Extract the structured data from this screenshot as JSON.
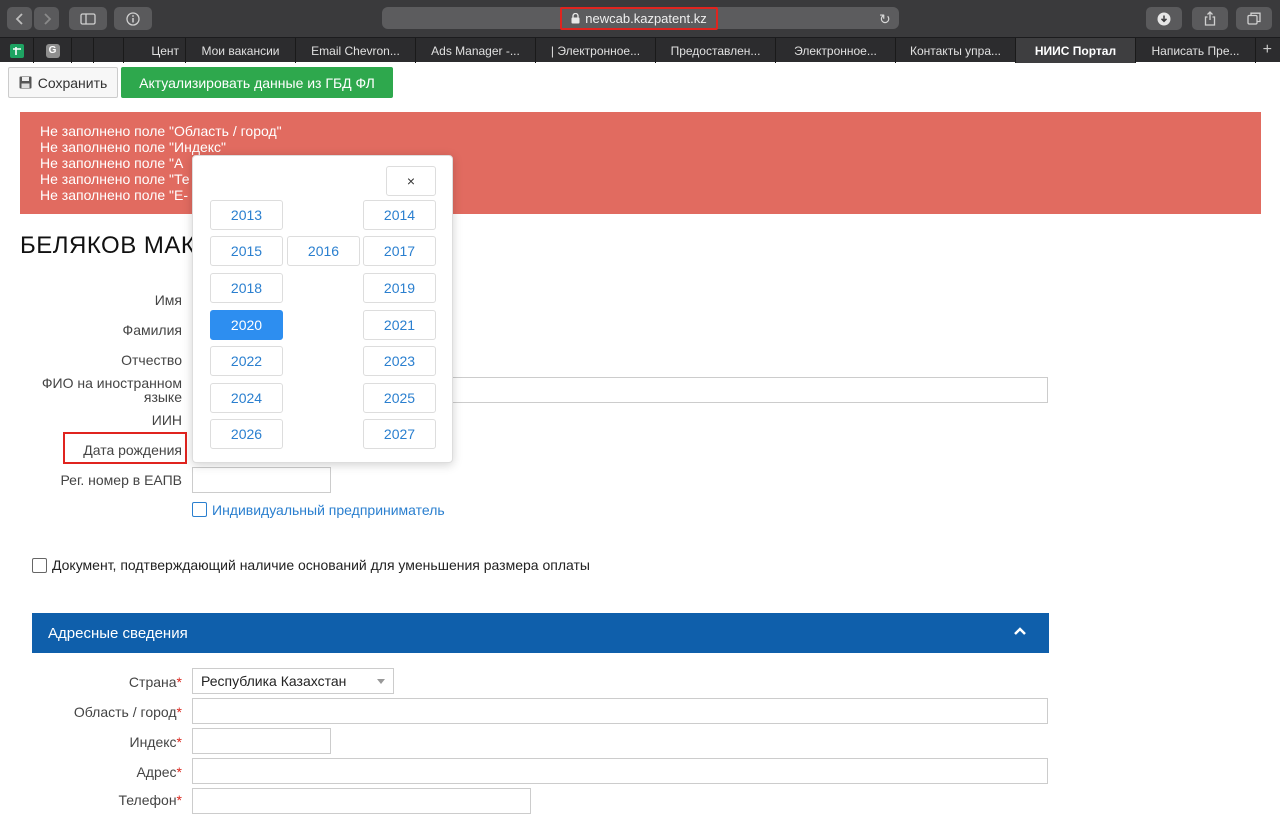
{
  "browser": {
    "url": "newcab.kazpatent.kz",
    "tabs": [
      "Цент",
      "Мои вакансии",
      "Email Chevron...",
      "Ads Manager -...",
      "| Электронное...",
      "Предоставлен...",
      "Электронное...",
      "Контакты упра...",
      "НИИС Портал",
      "Написать Пре..."
    ],
    "favicon_g": "G"
  },
  "toolbar": {
    "save_label": "Сохранить",
    "update_label": "Актуализировать данные из ГБД ФЛ"
  },
  "alert": {
    "lines": [
      "Не заполнено поле \"Область / город\"",
      "Не заполнено поле \"Индекс\"",
      "Не заполнено поле \"А",
      "Не заполнено поле \"Те",
      "Не заполнено поле \"E-"
    ]
  },
  "person": {
    "name_title": "БЕЛЯКОВ МАК"
  },
  "form": {
    "first_name": "Имя",
    "last_name": "Фамилия",
    "patronymic": "Отчество",
    "foreign_name_1": "ФИО на иностранном",
    "foreign_name_2": "языке",
    "iin": "ИИН",
    "birth_date": "Дата рождения",
    "eapv_reg": "Рег. номер в ЕАПВ",
    "entrepreneur": "Индивидуальный предприниматель",
    "discount_doc": "Документ, подтверждающий наличие оснований для уменьшения размера оплаты"
  },
  "address": {
    "section_title": "Адресные сведения",
    "country_label": "Страна",
    "country_value": "Республика Казахстан",
    "region_label": "Область / город",
    "index_label": "Индекс",
    "address_label": "Адрес",
    "phone_label": "Телефон",
    "required_mark": "*"
  },
  "year_picker": {
    "close": "×",
    "years": [
      "2013",
      "2014",
      "2015",
      "2016",
      "2017",
      "2018",
      "2019",
      "2020",
      "2021",
      "2022",
      "2023",
      "2024",
      "2025",
      "2026",
      "2027"
    ],
    "selected": "2020"
  },
  "colors": {
    "alert_bg": "#e16b60",
    "update_btn": "#2ea84d",
    "section_head": "#0f5fab",
    "selected_year": "#2d8ef0",
    "link_blue": "#2a7fcf"
  }
}
